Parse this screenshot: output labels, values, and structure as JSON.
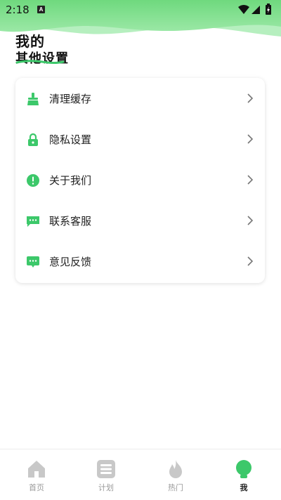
{
  "status_bar": {
    "time": "2:18",
    "app_badge": "A"
  },
  "header": {
    "title_line1": "我的",
    "title_line2": "其他设置"
  },
  "menu": [
    {
      "label": "清理缓存",
      "icon": "broom-icon"
    },
    {
      "label": "隐私设置",
      "icon": "lock-icon"
    },
    {
      "label": "关于我们",
      "icon": "info-exclamation-icon"
    },
    {
      "label": "联系客服",
      "icon": "chat-bubble-icon"
    },
    {
      "label": "意见反馈",
      "icon": "feedback-bubble-icon"
    }
  ],
  "tabs": [
    {
      "label": "首页",
      "icon": "home-icon",
      "active": false
    },
    {
      "label": "计划",
      "icon": "plan-list-icon",
      "active": false
    },
    {
      "label": "热门",
      "icon": "fire-icon",
      "active": false
    },
    {
      "label": "我",
      "icon": "profile-icon",
      "active": true
    }
  ],
  "colors": {
    "accent": "#3cc86a",
    "header_green": "#8ee39a",
    "inactive": "#c8c8c8"
  }
}
